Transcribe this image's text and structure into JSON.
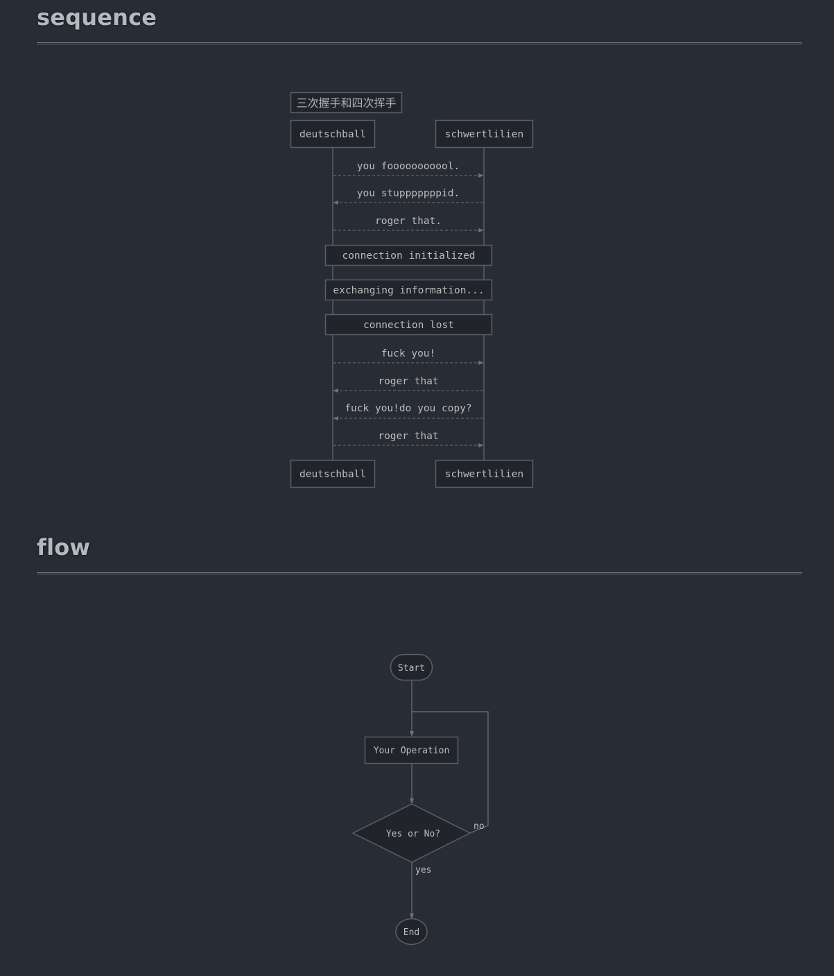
{
  "headings": {
    "sequence": "sequence",
    "flow": "flow"
  },
  "sequence": {
    "title": "三次握手和四次挥手",
    "participants": [
      "deutschball",
      "schwertlilien"
    ],
    "messages": [
      {
        "text": "you fooooooooool.",
        "from": "deutschball",
        "to": "schwertlilien",
        "style": "dashed"
      },
      {
        "text": "you stupppppppid.",
        "from": "schwertlilien",
        "to": "deutschball",
        "style": "dashed"
      },
      {
        "text": "roger that.",
        "from": "deutschball",
        "to": "schwertlilien",
        "style": "dashed"
      }
    ],
    "notes": [
      {
        "text": "connection initialized",
        "over": [
          "deutschball",
          "schwertlilien"
        ]
      },
      {
        "text": "exchanging information...",
        "over": [
          "deutschball",
          "schwertlilien"
        ]
      },
      {
        "text": "connection lost",
        "over": [
          "deutschball",
          "schwertlilien"
        ]
      }
    ],
    "messages_after": [
      {
        "text": "fuck you!",
        "from": "deutschball",
        "to": "schwertlilien",
        "style": "dashed"
      },
      {
        "text": "roger that",
        "from": "schwertlilien",
        "to": "deutschball",
        "style": "dashed"
      },
      {
        "text": "fuck you!do you copy?",
        "from": "schwertlilien",
        "to": "deutschball",
        "style": "dashed"
      },
      {
        "text": "roger that",
        "from": "deutschball",
        "to": "schwertlilien",
        "style": "dashed"
      }
    ]
  },
  "flow": {
    "nodes": {
      "start": {
        "type": "start",
        "text": "Start"
      },
      "operation": {
        "type": "operation",
        "text": "Your Operation"
      },
      "condition": {
        "type": "condition",
        "text": "Yes or No?"
      },
      "end": {
        "type": "end",
        "text": "End"
      }
    },
    "edges": [
      {
        "from": "start",
        "to": "operation",
        "label": ""
      },
      {
        "from": "operation",
        "to": "condition",
        "label": ""
      },
      {
        "from": "condition",
        "to": "end",
        "label": "yes"
      },
      {
        "from": "condition",
        "to": "operation",
        "label": "no"
      }
    ]
  }
}
